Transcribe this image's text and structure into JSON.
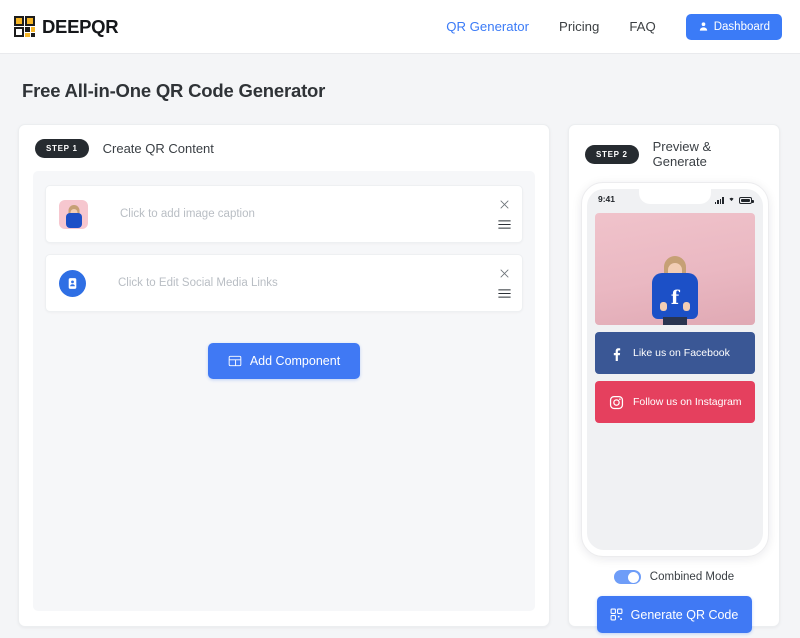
{
  "header": {
    "brand_name": "DEEPQR",
    "brand_icon": "qr-code-logo-icon",
    "nav": [
      {
        "label": "QR Generator",
        "active": true
      },
      {
        "label": "Pricing",
        "active": false
      },
      {
        "label": "FAQ",
        "active": false
      }
    ],
    "dashboard_button": {
      "label": "Dashboard",
      "icon": "user-icon",
      "color": "#3b7bf7"
    }
  },
  "page": {
    "title": "Free All-in-One QR Code Generator"
  },
  "left_panel": {
    "step_badge": "STEP 1",
    "title": "Create QR Content",
    "components": [
      {
        "icon": "image-thumbnail-icon",
        "placeholder": "Click to add image caption",
        "close_icon": "close-icon",
        "drag_icon": "drag-handle-icon"
      },
      {
        "icon": "contact-card-icon",
        "placeholder": "Click to Edit Social Media Links",
        "close_icon": "close-icon",
        "drag_icon": "drag-handle-icon"
      }
    ],
    "add_button": {
      "label": "Add Component",
      "icon": "add-component-icon",
      "color": "#4079f4"
    }
  },
  "right_panel": {
    "step_badge": "STEP 2",
    "title": "Preview & Generate",
    "phone": {
      "status_time": "9:41",
      "signal_icon": "cellular-signal-icon",
      "wifi_icon": "wifi-icon",
      "battery_icon": "battery-icon",
      "preview_image_alt": "woman-holding-facebook-logo",
      "buttons": [
        {
          "label": "Like us on Facebook",
          "icon": "facebook-icon",
          "color": "#3a5795"
        },
        {
          "label": "Follow us on Instagram",
          "icon": "instagram-icon",
          "color": "#e5405e"
        }
      ]
    },
    "toggle": {
      "label": "Combined Mode",
      "state": "on",
      "color": "#6e9df8"
    },
    "generate_button": {
      "label": "Generate QR Code",
      "icon": "qr-code-icon",
      "color": "#4079f4"
    }
  }
}
